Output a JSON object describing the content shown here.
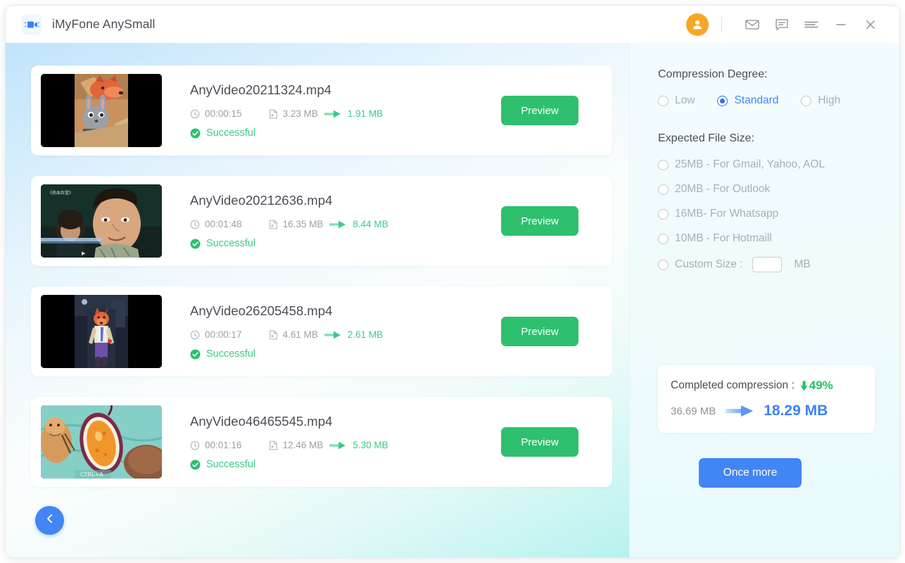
{
  "window": {
    "app_title": "iMyFone AnySmall",
    "logo_icon": "video-camera-icon"
  },
  "titlebar": {
    "avatar_icon": "user-avatar-icon",
    "mail_icon": "mail-icon",
    "feedback_icon": "chat-bubble-icon",
    "menu_icon": "hamburger-menu-icon",
    "minimize_icon": "minimize-icon",
    "close_icon": "close-icon"
  },
  "files": [
    {
      "name": "AnyVideo20211324.mp4",
      "duration": "00:00:15",
      "original_size": "3.23 MB",
      "new_size": "1.91 MB",
      "status": "Successful",
      "preview_label": "Preview",
      "thumb": "zootopia-fox-bunny"
    },
    {
      "name": "AnyVideo20212636.mp4",
      "duration": "00:01:48",
      "original_size": "16.35 MB",
      "new_size": "8.44 MB",
      "status": "Successful",
      "preview_label": "Preview",
      "thumb": "movie-scene-man"
    },
    {
      "name": "AnyVideo26205458.mp4",
      "duration": "00:00:17",
      "original_size": "4.61 MB",
      "new_size": "2.61 MB",
      "status": "Successful",
      "preview_label": "Preview",
      "thumb": "zootopia-fox-standing"
    },
    {
      "name": "AnyVideo46465545.mp4",
      "duration": "00:01:16",
      "original_size": "12.46 MB",
      "new_size": "5.30 MB",
      "status": "Successful",
      "preview_label": "Preview",
      "thumb": "cartoon-food-scene"
    }
  ],
  "nav": {
    "back_icon": "chevron-left-icon"
  },
  "settings": {
    "degree_label": "Compression Degree:",
    "degree_options": [
      {
        "label": "Low",
        "selected": false
      },
      {
        "label": "Standard",
        "selected": true
      },
      {
        "label": "High",
        "selected": false
      }
    ],
    "expected_size_label": "Expected File Size:",
    "size_options": [
      {
        "label": "25MB - For Gmail, Yahoo, AOL",
        "selected": false
      },
      {
        "label": "20MB - For Outlook",
        "selected": false
      },
      {
        "label": "16MB- For Whatsapp",
        "selected": false
      },
      {
        "label": "10MB - For Hotmaill",
        "selected": false
      },
      {
        "label": "Custom Size :",
        "selected": false
      }
    ],
    "custom_size_value": "",
    "custom_size_placeholder": "",
    "custom_size_unit": "MB"
  },
  "result": {
    "label": "Completed compression :",
    "percent": "49%",
    "percent_icon": "down-arrow-icon",
    "size_before": "36.69 MB",
    "size_after": "18.29 MB",
    "arrow_icon": "right-arrow-icon"
  },
  "actions": {
    "once_more_label": "Once more"
  },
  "colors": {
    "accent_blue": "#4285f4",
    "success_green": "#2ec06e",
    "avatar_orange": "#f5a623",
    "result_blue": "#3b82f6"
  }
}
